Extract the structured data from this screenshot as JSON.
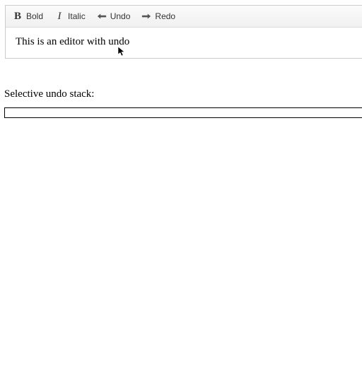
{
  "toolbar": {
    "bold_label": "Bold",
    "italic_label": "Italic",
    "undo_label": "Undo",
    "redo_label": "Redo"
  },
  "editor": {
    "content": "This is an editor with undo"
  },
  "stack": {
    "label": "Selective undo stack:"
  }
}
